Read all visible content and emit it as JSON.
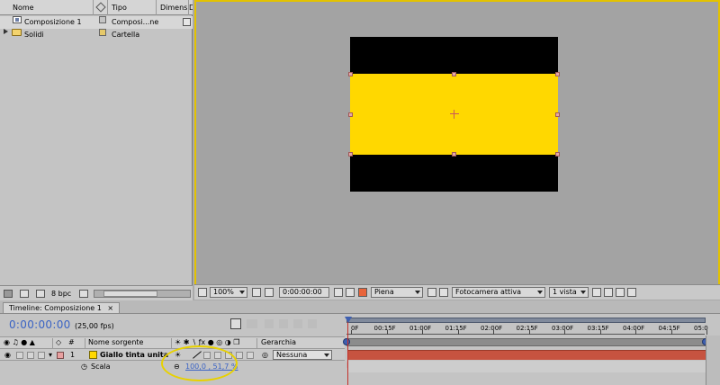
{
  "project_panel": {
    "columns": {
      "name": "Nome",
      "type": "Tipo",
      "dimensions": "Dimensi...",
      "extra": "D"
    },
    "items": [
      {
        "name": "Composizione 1",
        "type": "Composi...ne",
        "icon": "composition-icon",
        "label_color": "#c4c4c4"
      },
      {
        "name": "Solidi",
        "type": "Cartella",
        "icon": "folder-icon",
        "label_color": "#e6c96a"
      }
    ],
    "footer": {
      "bpc": "8 bpc"
    }
  },
  "composition_viewer": {
    "background_color": "#000000",
    "solid_color": "#ffd800",
    "toolbar": {
      "zoom": "100%",
      "timecode": "0:00:00:00",
      "resolution": "Piena",
      "camera": "Fotocamera attiva",
      "views": "1 vista"
    }
  },
  "timeline": {
    "tab_title": "Timeline: Composizione 1",
    "current_time": "0:00:00:00",
    "fps": "(25,00 fps)",
    "headers": {
      "number": "#",
      "source_name": "Nome sorgente",
      "parent": "Gerarchia"
    },
    "ruler_ticks": [
      "0F",
      "00:15F",
      "01:00F",
      "01:15F",
      "02:00F",
      "02:15F",
      "03:00F",
      "03:15F",
      "04:00F",
      "04:15F",
      "05:0"
    ],
    "layers": [
      {
        "number": "1",
        "name": "Giallo tinta unita",
        "parent": "Nessuna",
        "label_color": "#e8a0a0",
        "bar_color": "#c65340",
        "properties": [
          {
            "name": "Scala",
            "value": "100,0 , 51,7 %"
          }
        ]
      }
    ],
    "highlight_color": "#e8d100"
  }
}
